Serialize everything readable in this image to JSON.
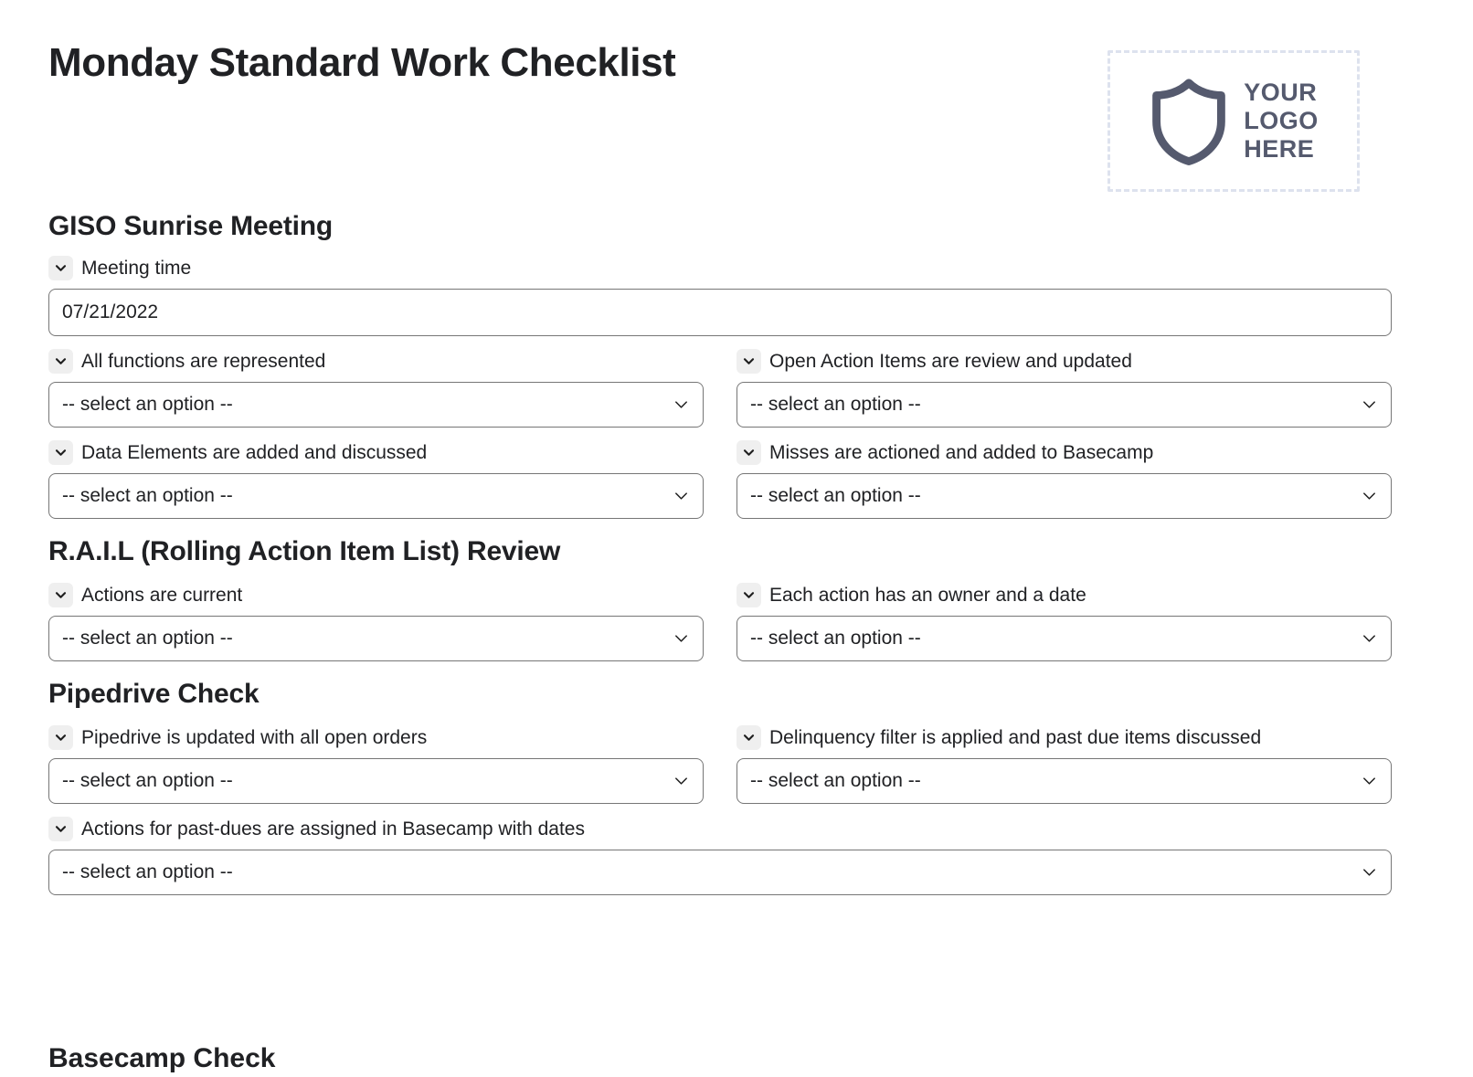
{
  "document": {
    "title": "Monday Standard Work Checklist"
  },
  "logo": {
    "icon": "shield-icon",
    "line1": "YOUR",
    "line2": "LOGO",
    "line3": "HERE"
  },
  "common": {
    "select_placeholder": "-- select an option --",
    "expand_icon": "chevron-down-icon",
    "select_arrow_icon": "chevron-down-icon",
    "border_color": "#767676",
    "badge_color": "#efefef",
    "logo_color": "#555a6e",
    "dash_color": "#dde2ee"
  },
  "sections": [
    {
      "heading": "GISO Sunrise Meeting",
      "date_field": {
        "label": "Meeting time",
        "value": "07/21/2022"
      },
      "fields": [
        {
          "label": "All functions are represented",
          "value": "-- select an option --"
        },
        {
          "label": "Open Action Items are review and updated",
          "value": "-- select an option --"
        },
        {
          "label": "Data Elements are added and discussed",
          "value": "-- select an option --"
        },
        {
          "label": "Misses are actioned and added to Basecamp",
          "value": "-- select an option --"
        }
      ]
    },
    {
      "heading": "R.A.I.L (Rolling Action Item List) Review",
      "fields": [
        {
          "label": "Actions are current",
          "value": "-- select an option --"
        },
        {
          "label": "Each action has an owner and a date",
          "value": "-- select an option --"
        }
      ]
    },
    {
      "heading": "Pipedrive Check",
      "fields": [
        {
          "label": "Pipedrive is updated with all open orders",
          "value": "-- select an option --"
        },
        {
          "label": "Delinquency filter is applied and past due items discussed",
          "value": "-- select an option --"
        },
        {
          "label": "Actions for past-dues are assigned in Basecamp with dates",
          "value": "-- select an option --"
        }
      ]
    }
  ],
  "next_section_partial": {
    "heading": "Basecamp Check"
  }
}
